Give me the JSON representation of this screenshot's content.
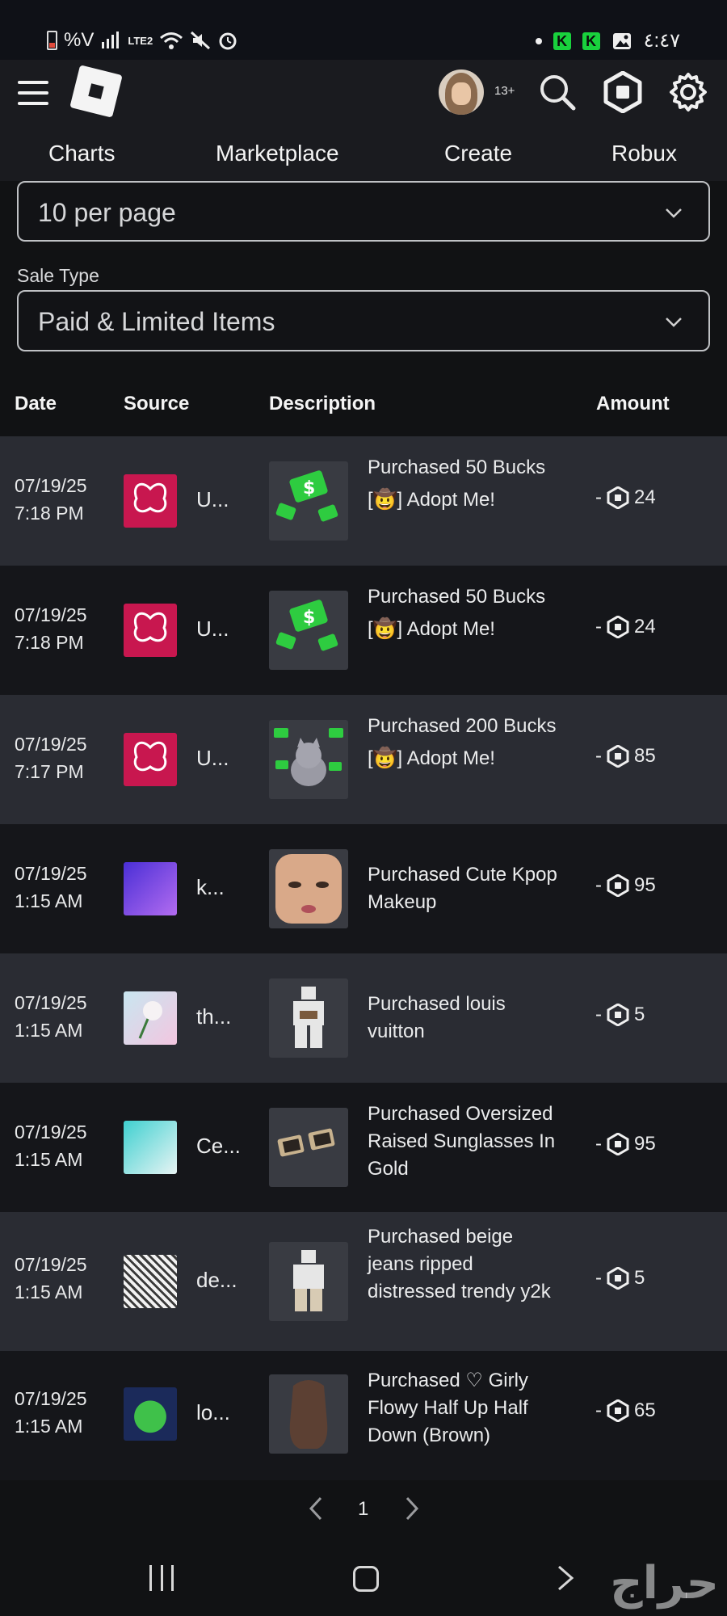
{
  "status_bar": {
    "left_text": "%V",
    "network": "LTE2",
    "time": "٤:٤٧"
  },
  "header": {
    "age_badge": "13+"
  },
  "tabs": [
    {
      "label": "Charts"
    },
    {
      "label": "Marketplace"
    },
    {
      "label": "Create"
    },
    {
      "label": "Robux"
    }
  ],
  "filters": {
    "per_page": "10 per page",
    "sale_type_label": "Sale Type",
    "sale_type_value": "Paid & Limited Items"
  },
  "table": {
    "headers": {
      "date": "Date",
      "source": "Source",
      "description": "Description",
      "amount": "Amount"
    },
    "rows": [
      {
        "date": "07/19/25",
        "time": "7:18 PM",
        "source": "U...",
        "description": "Purchased 50 Bucks",
        "game": "[🤠] Adopt Me!",
        "amount_sign": "-",
        "amount": "24"
      },
      {
        "date": "07/19/25",
        "time": "7:18 PM",
        "source": "U...",
        "description": "Purchased 50 Bucks",
        "game": "[🤠] Adopt Me!",
        "amount_sign": "-",
        "amount": "24"
      },
      {
        "date": "07/19/25",
        "time": "7:17 PM",
        "source": "U...",
        "description": "Purchased 200 Bucks",
        "game": "[🤠] Adopt Me!",
        "amount_sign": "-",
        "amount": "85"
      },
      {
        "date": "07/19/25",
        "time": "1:15 AM",
        "source": "k...",
        "description": "Purchased Cute Kpop Makeup",
        "game": "",
        "amount_sign": "-",
        "amount": "95"
      },
      {
        "date": "07/19/25",
        "time": "1:15 AM",
        "source": "th...",
        "description": "Purchased louis vuitton",
        "game": "",
        "amount_sign": "-",
        "amount": "5"
      },
      {
        "date": "07/19/25",
        "time": "1:15 AM",
        "source": "Ce...",
        "description": "Purchased Oversized Raised Sunglasses In Gold",
        "game": "",
        "amount_sign": "-",
        "amount": "95"
      },
      {
        "date": "07/19/25",
        "time": "1:15 AM",
        "source": "de...",
        "description": "Purchased beige jeans ripped distressed trendy y2k",
        "game": "",
        "amount_sign": "-",
        "amount": "5"
      },
      {
        "date": "07/19/25",
        "time": "1:15 AM",
        "source": "lo...",
        "description": "Purchased ♡ Girly Flowy Half Up Half Down (Brown)",
        "game": "",
        "amount_sign": "-",
        "amount": "65"
      }
    ]
  },
  "pagination": {
    "page": "1"
  },
  "watermark": "حراج",
  "colors": {
    "accent_green": "#19d13d",
    "row_alt": "#2a2c33",
    "row_plain": "#15161a"
  }
}
